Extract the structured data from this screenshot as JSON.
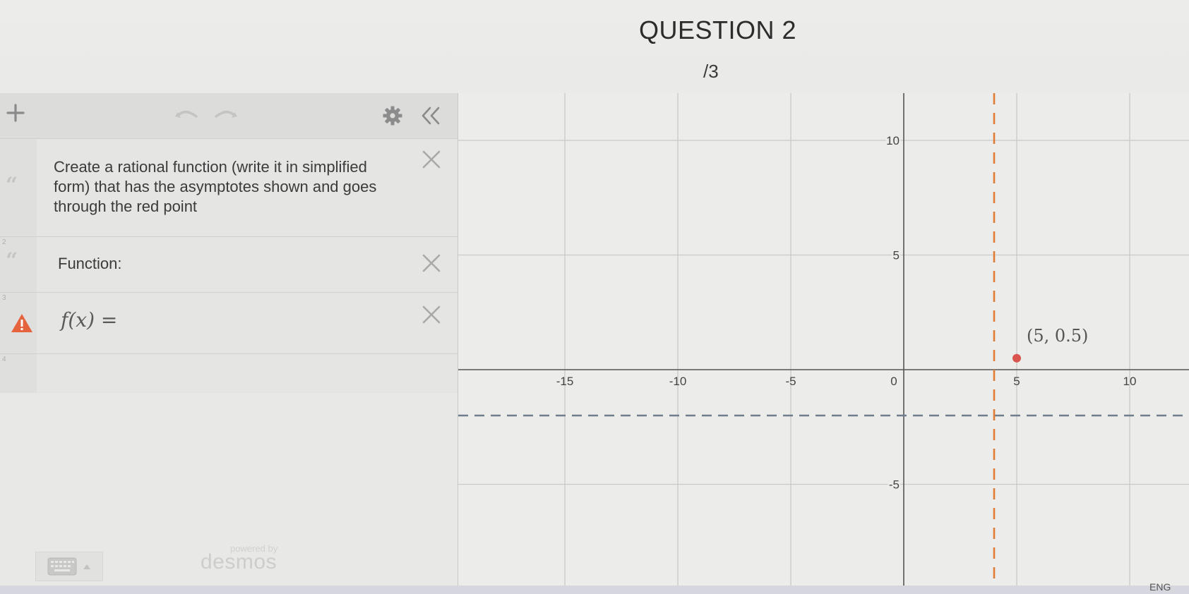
{
  "question": {
    "title": "QUESTION 2",
    "points": "/3"
  },
  "toolbar": {
    "add_icon": "plus-icon",
    "undo_icon": "undo-icon",
    "redo_icon": "redo-icon",
    "settings_icon": "gear-icon",
    "collapse_icon": "double-chevron-left-icon"
  },
  "expressions": [
    {
      "index": "",
      "type": "note",
      "text_line1": "Create a rational function (write it in simplified",
      "text_line2": "form) that has the asymptotes shown and goes",
      "text_line3": "through the red point"
    },
    {
      "index": "2",
      "type": "note",
      "text": "Function:"
    },
    {
      "index": "3",
      "type": "expression",
      "latex": "f(x) =",
      "status": "warning"
    },
    {
      "index": "4",
      "type": "empty"
    }
  ],
  "footer": {
    "powered_by": "powered by",
    "brand": "desmos"
  },
  "graph": {
    "x_ticks": [
      "-15",
      "-10",
      "-5",
      "0",
      "5",
      "10"
    ],
    "y_ticks": [
      "10",
      "5",
      "-5"
    ],
    "point_label": "(5, 0.5)",
    "point": {
      "x": 5,
      "y": 0.5
    },
    "vertical_asymptote_x": 4,
    "horizontal_asymptote_y": -2,
    "asymptote_color": "#e07b3a",
    "horizontal_asymptote_color": "#6f7d8c",
    "point_color": "#d9534f"
  },
  "system": {
    "lang": "ENG"
  }
}
